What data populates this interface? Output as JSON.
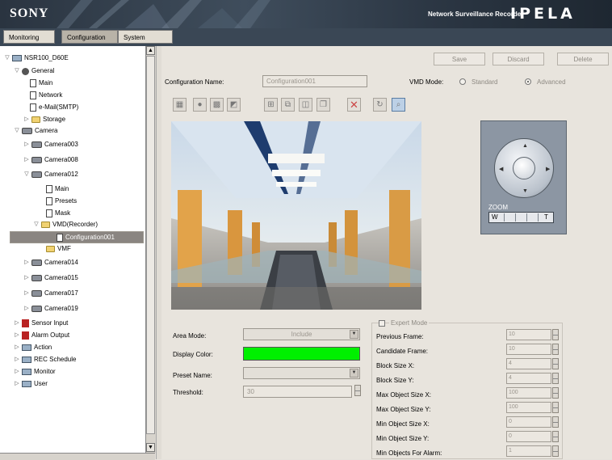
{
  "header": {
    "brand": "SONY",
    "product": "Network Surveillance Recorder",
    "logo": "IPELA"
  },
  "tabs": [
    {
      "label": "Monitoring",
      "active": false
    },
    {
      "label": "Configuration",
      "active": true
    },
    {
      "label": "System",
      "active": false
    }
  ],
  "tree": {
    "items": [
      {
        "label": "NSR100_D60E",
        "icon": "recorder-icon"
      },
      {
        "label": "General",
        "icon": "gear-icon"
      },
      {
        "label": "Main",
        "icon": "page-icon"
      },
      {
        "label": "Network",
        "icon": "page-icon"
      },
      {
        "label": "e-Mail(SMTP)",
        "icon": "page-icon"
      },
      {
        "label": "Storage",
        "icon": "folder-icon"
      },
      {
        "label": "Camera",
        "icon": "camera-icon"
      },
      {
        "label": "Camera003",
        "icon": "camera-icon"
      },
      {
        "label": "Camera008",
        "icon": "camera-icon"
      },
      {
        "label": "Camera012",
        "icon": "camera-icon"
      },
      {
        "label": "Main",
        "icon": "page-icon"
      },
      {
        "label": "Presets",
        "icon": "page-icon"
      },
      {
        "label": "Mask",
        "icon": "page-icon"
      },
      {
        "label": "VMD(Recorder)",
        "icon": "folder-icon"
      },
      {
        "label": "Configuration001",
        "icon": "page-icon",
        "selected": true
      },
      {
        "label": "VMF",
        "icon": "folder-icon"
      },
      {
        "label": "Camera014",
        "icon": "camera-icon"
      },
      {
        "label": "Camera015",
        "icon": "camera-icon"
      },
      {
        "label": "Camera017",
        "icon": "camera-icon"
      },
      {
        "label": "Camera019",
        "icon": "camera-icon"
      },
      {
        "label": "Sensor Input",
        "icon": "sensor-icon"
      },
      {
        "label": "Alarm Output",
        "icon": "alarm-icon"
      },
      {
        "label": "Action",
        "icon": "action-icon"
      },
      {
        "label": "REC Schedule",
        "icon": "schedule-icon"
      },
      {
        "label": "Monitor",
        "icon": "monitor-icon"
      },
      {
        "label": "User",
        "icon": "user-icon"
      }
    ]
  },
  "toolbar": {
    "save_label": "Save",
    "discard_label": "Discard",
    "delete_label": "Delete"
  },
  "config": {
    "name_label": "Configuration Name:",
    "name_value": "Configuration001",
    "vmd_mode_label": "VMD Mode:",
    "vmd_standard_label": "Standard",
    "vmd_advanced_label": "Advanced",
    "vmd_mode_selected": "Advanced"
  },
  "ptz": {
    "zoom_label": "ZOOM",
    "wide_label": "W",
    "tele_label": "T"
  },
  "area": {
    "area_mode_label": "Area Mode:",
    "area_mode_value": "Include",
    "display_color_label": "Display Color:",
    "display_color_value": "#00f000",
    "preset_name_label": "Preset Name:",
    "preset_name_value": "",
    "threshold_label": "Threshold:",
    "threshold_value": "30"
  },
  "expert": {
    "label": "Expert Mode",
    "checked": false,
    "fields": [
      {
        "label": "Previous Frame:",
        "value": "10"
      },
      {
        "label": "Candidate Frame:",
        "value": "10"
      },
      {
        "label": "Block Size X:",
        "value": "4"
      },
      {
        "label": "Block Size Y:",
        "value": "4"
      },
      {
        "label": "Max Object Size X:",
        "value": "100"
      },
      {
        "label": "Max Object Size Y:",
        "value": "100"
      },
      {
        "label": "Min Object Size X:",
        "value": "0"
      },
      {
        "label": "Min Object Size Y:",
        "value": "0"
      },
      {
        "label": "Min Objects For Alarm:",
        "value": "1"
      }
    ]
  },
  "tools": [
    "grid-icon",
    "dot-icon",
    "grid-dots-icon",
    "polygon-icon",
    "add-area-icon",
    "move-area-icon",
    "resize-area-icon",
    "copy-area-icon",
    "delete-icon",
    "refresh-icon",
    "zoom-icon"
  ]
}
